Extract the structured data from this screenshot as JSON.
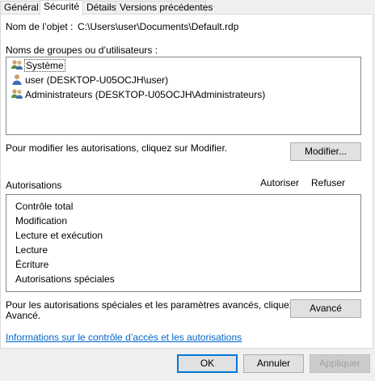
{
  "tabs": [
    {
      "label": "Général"
    },
    {
      "label": "Sécurité"
    },
    {
      "label": "Détails"
    },
    {
      "label": "Versions précédentes"
    }
  ],
  "object": {
    "label": "Nom de l’objet :",
    "value": "C:\\Users\\user\\Documents\\Default.rdp"
  },
  "groups": {
    "heading": "Noms de groupes ou d’utilisateurs :",
    "items": [
      {
        "label": "Système",
        "icon": "user-group-icon"
      },
      {
        "label": "user (DESKTOP-U05OCJH\\user)",
        "icon": "user-icon"
      },
      {
        "label": "Administrateurs (DESKTOP-U05OCJH\\Administrateurs)",
        "icon": "user-group-icon"
      }
    ]
  },
  "modify": {
    "hint": "Pour modifier les autorisations, cliquez sur Modifier.",
    "button": "Modifier..."
  },
  "permissions": {
    "heading": "Autorisations",
    "col_allow": "Autoriser",
    "col_deny": "Refuser",
    "items": [
      {
        "label": "Contrôle total"
      },
      {
        "label": "Modification"
      },
      {
        "label": "Lecture et exécution"
      },
      {
        "label": "Lecture"
      },
      {
        "label": "Écriture"
      },
      {
        "label": "Autorisations spéciales"
      }
    ]
  },
  "advanced": {
    "hint_line1": "Pour les autorisations spéciales et les paramètres avancés, cliquez sur",
    "hint_line2": "Avancé.",
    "button": "Avancé"
  },
  "info_link": "Informations sur le contrôle d’accès et les autorisations",
  "dialog_buttons": {
    "ok": "OK",
    "cancel": "Annuler",
    "apply": "Appliquer"
  }
}
